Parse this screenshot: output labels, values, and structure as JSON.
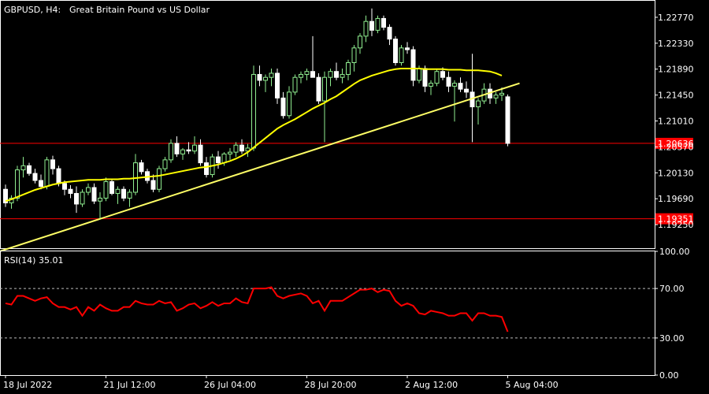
{
  "header": {
    "symbol_timeframe": "GBPUSD, H4:",
    "description": "Great Britain Pound vs US Dollar"
  },
  "indicator": {
    "label": "RSI(14) 35.01"
  },
  "colors": {
    "background": "#000000",
    "frame": "#ffffff",
    "bull_candle": "#90ee90",
    "bear_candle": "#ffffff",
    "moving_average": "#ffff00",
    "trendline": "#ffff66",
    "hline": "#ff0000",
    "rsi_line": "#ff0000",
    "price_marker": "#ff0000"
  },
  "chart_data": [
    {
      "type": "candlestick",
      "title": "GBPUSD, H4: Great Britain Pound vs US Dollar",
      "ylim": [
        1.1885,
        1.2305
      ],
      "y_ticks": [
        "1.22770",
        "1.22330",
        "1.21890",
        "1.21450",
        "1.21010",
        "1.20570",
        "1.20130",
        "1.19690",
        "1.19250"
      ],
      "x_ticks": [
        "18 Jul 2022",
        "21 Jul 12:00",
        "26 Jul 04:00",
        "28 Jul 20:00",
        "2 Aug 12:00",
        "5 Aug 04:00"
      ],
      "candles": [
        [
          1.1985,
          1.1993,
          1.1955,
          1.1962
        ],
        [
          1.1962,
          1.1975,
          1.1952,
          1.197
        ],
        [
          1.197,
          1.2025,
          1.1965,
          1.2018
        ],
        [
          1.2018,
          1.204,
          1.2005,
          1.2025
        ],
        [
          1.2025,
          1.203,
          1.2008,
          1.2012
        ],
        [
          1.2012,
          1.202,
          1.1995,
          1.2
        ],
        [
          1.2,
          1.201,
          1.1985,
          1.199
        ],
        [
          1.199,
          1.204,
          1.1985,
          1.2035
        ],
        [
          1.2035,
          1.2042,
          1.201,
          1.202
        ],
        [
          1.202,
          1.2025,
          1.199,
          1.1995
        ],
        [
          1.1995,
          1.2,
          1.1975,
          1.1985
        ],
        [
          1.1985,
          1.1992,
          1.197,
          1.1978
        ],
        [
          1.1978,
          1.199,
          1.1945,
          1.196
        ],
        [
          1.196,
          1.1985,
          1.1955,
          1.198
        ],
        [
          1.198,
          1.1995,
          1.1975,
          1.1988
        ],
        [
          1.1988,
          1.1995,
          1.196,
          1.1965
        ],
        [
          1.1965,
          1.198,
          1.1935,
          1.197
        ],
        [
          1.197,
          1.2005,
          1.1965,
          1.1998
        ],
        [
          1.1998,
          1.2002,
          1.1975,
          1.1978
        ],
        [
          1.1978,
          1.199,
          1.196,
          1.1985
        ],
        [
          1.1985,
          1.199,
          1.1965,
          1.197
        ],
        [
          1.197,
          1.1985,
          1.1955,
          1.198
        ],
        [
          1.198,
          1.2045,
          1.1975,
          1.203
        ],
        [
          1.203,
          1.2035,
          1.201,
          1.2015
        ],
        [
          1.2015,
          1.202,
          1.1995,
          1.2
        ],
        [
          1.2,
          1.201,
          1.198,
          1.1985
        ],
        [
          1.1985,
          1.2025,
          1.198,
          1.202
        ],
        [
          1.202,
          1.204,
          1.2015,
          1.2035
        ],
        [
          1.2035,
          1.207,
          1.203,
          1.2063
        ],
        [
          1.2063,
          1.2075,
          1.204,
          1.2045
        ],
        [
          1.2045,
          1.2055,
          1.2035,
          1.2052
        ],
        [
          1.2052,
          1.2065,
          1.2045,
          1.205
        ],
        [
          1.205,
          1.2075,
          1.2045,
          1.206
        ],
        [
          1.206,
          1.207,
          1.2025,
          1.203
        ],
        [
          1.203,
          1.204,
          1.2005,
          1.201
        ],
        [
          1.201,
          1.2045,
          1.2005,
          1.204
        ],
        [
          1.204,
          1.205,
          1.202,
          1.203
        ],
        [
          1.203,
          1.2048,
          1.2025,
          1.2045
        ],
        [
          1.2045,
          1.2055,
          1.2035,
          1.2048
        ],
        [
          1.2048,
          1.2065,
          1.204,
          1.206
        ],
        [
          1.206,
          1.207,
          1.2045,
          1.205
        ],
        [
          1.205,
          1.2062,
          1.204,
          1.2055
        ],
        [
          1.2055,
          1.2195,
          1.205,
          1.218
        ],
        [
          1.218,
          1.2195,
          1.216,
          1.217
        ],
        [
          1.217,
          1.218,
          1.215,
          1.2175
        ],
        [
          1.2175,
          1.219,
          1.216,
          1.2182
        ],
        [
          1.2182,
          1.219,
          1.213,
          1.214
        ],
        [
          1.214,
          1.215,
          1.2105,
          1.211
        ],
        [
          1.211,
          1.216,
          1.2105,
          1.215
        ],
        [
          1.215,
          1.218,
          1.2145,
          1.2175
        ],
        [
          1.2175,
          1.2185,
          1.2165,
          1.218
        ],
        [
          1.218,
          1.219,
          1.217,
          1.2185
        ],
        [
          1.2185,
          1.2245,
          1.2175,
          1.2175
        ],
        [
          1.2175,
          1.2182,
          1.213,
          1.2135
        ],
        [
          1.2135,
          1.2185,
          1.2065,
          1.2175
        ],
        [
          1.2175,
          1.219,
          1.216,
          1.2185
        ],
        [
          1.2185,
          1.22,
          1.217,
          1.2175
        ],
        [
          1.2175,
          1.219,
          1.2165,
          1.218
        ],
        [
          1.218,
          1.2205,
          1.217,
          1.22
        ],
        [
          1.22,
          1.223,
          1.2185,
          1.2225
        ],
        [
          1.2225,
          1.225,
          1.2215,
          1.2245
        ],
        [
          1.2245,
          1.228,
          1.2235,
          1.227
        ],
        [
          1.227,
          1.2292,
          1.2245,
          1.2255
        ],
        [
          1.2255,
          1.228,
          1.225,
          1.2275
        ],
        [
          1.2275,
          1.228,
          1.2255,
          1.226
        ],
        [
          1.226,
          1.2265,
          1.223,
          1.224
        ],
        [
          1.224,
          1.2245,
          1.2195,
          1.22
        ],
        [
          1.22,
          1.223,
          1.2195,
          1.2225
        ],
        [
          1.2225,
          1.2235,
          1.2215,
          1.2222
        ],
        [
          1.2222,
          1.2228,
          1.216,
          1.217
        ],
        [
          1.217,
          1.2195,
          1.2165,
          1.219
        ],
        [
          1.219,
          1.2195,
          1.215,
          1.216
        ],
        [
          1.216,
          1.217,
          1.2145,
          1.2165
        ],
        [
          1.2165,
          1.219,
          1.216,
          1.2185
        ],
        [
          1.2185,
          1.2192,
          1.217,
          1.2175
        ],
        [
          1.2175,
          1.2185,
          1.215,
          1.216
        ],
        [
          1.216,
          1.217,
          1.21,
          1.2165
        ],
        [
          1.2165,
          1.2175,
          1.215,
          1.2155
        ],
        [
          1.2155,
          1.2168,
          1.214,
          1.215
        ],
        [
          1.215,
          1.2215,
          1.2065,
          1.2125
        ],
        [
          1.2125,
          1.214,
          1.2095,
          1.2135
        ],
        [
          1.2135,
          1.2165,
          1.213,
          1.2155
        ],
        [
          1.2155,
          1.2165,
          1.213,
          1.214
        ],
        [
          1.214,
          1.215,
          1.213,
          1.2145
        ],
        [
          1.2145,
          1.2158,
          1.2135,
          1.2148
        ],
        [
          1.2142,
          1.2146,
          1.2058,
          1.2063
        ]
      ],
      "ma": [
        1.1965,
        1.1968,
        1.1972,
        1.1976,
        1.198,
        1.1984,
        1.1987,
        1.199,
        1.1993,
        1.1995,
        1.1997,
        1.1998,
        1.1999,
        1.2,
        1.2001,
        1.2001,
        1.2001,
        1.2002,
        1.2002,
        1.2002,
        1.2003,
        1.2003,
        1.2004,
        1.2005,
        1.2006,
        1.2007,
        1.2008,
        1.201,
        1.2012,
        1.2014,
        1.2016,
        1.2018,
        1.202,
        1.2022,
        1.2023,
        1.2025,
        1.2027,
        1.203,
        1.2033,
        1.2037,
        1.2042,
        1.2048,
        1.2056,
        1.2064,
        1.2072,
        1.208,
        1.2088,
        1.2094,
        1.2099,
        1.2104,
        1.211,
        1.2116,
        1.2122,
        1.2127,
        1.2132,
        1.2138,
        1.2143,
        1.215,
        1.2157,
        1.2164,
        1.217,
        1.2174,
        1.2178,
        1.2181,
        1.2184,
        1.2187,
        1.2189,
        1.219,
        1.219,
        1.219,
        1.219,
        1.2189,
        1.2189,
        1.2189,
        1.2189,
        1.2188,
        1.2188,
        1.2188,
        1.2187,
        1.2187,
        1.2187,
        1.2186,
        1.2185,
        1.2182,
        1.2178
      ],
      "trendline": [
        [
          -4,
          1.187
        ],
        [
          87,
          1.2165
        ]
      ],
      "hlines": [
        {
          "price": 1.2063,
          "label": "1.20636"
        },
        {
          "price": 1.1935,
          "label": "1.19351"
        }
      ],
      "current_price": "1.20636"
    },
    {
      "type": "line",
      "title": "RSI(14) 35.01",
      "ylim": [
        0,
        100
      ],
      "y_ticks": [
        "100.00",
        "70.00",
        "30.00",
        "0.00"
      ],
      "levels": [
        70,
        30
      ],
      "values": [
        58,
        57,
        64,
        64,
        62,
        60,
        62,
        63,
        58,
        55,
        55,
        53,
        55,
        48,
        55,
        52,
        57,
        54,
        52,
        52,
        55,
        55,
        60,
        58,
        57,
        57,
        60,
        58,
        59,
        52,
        54,
        57,
        58,
        54,
        56,
        59,
        56,
        58,
        58,
        62,
        59,
        58,
        70,
        70,
        70,
        71,
        64,
        62,
        64,
        65,
        66,
        64,
        58,
        60,
        52,
        60,
        60,
        60,
        63,
        66,
        69,
        69,
        70,
        67,
        69,
        68,
        60,
        56,
        58,
        56,
        50,
        49,
        52,
        51,
        50,
        48,
        48,
        50,
        50,
        44,
        50,
        50,
        48,
        48,
        47,
        35
      ]
    }
  ]
}
